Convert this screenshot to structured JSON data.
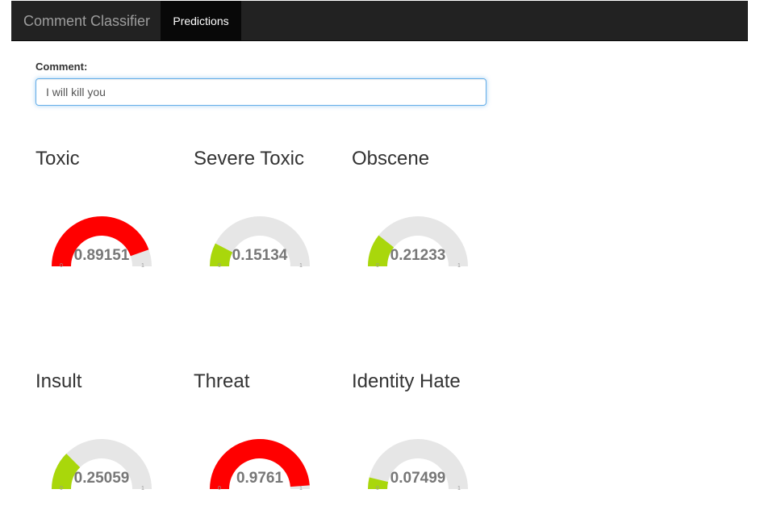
{
  "navbar": {
    "brand": "Comment Classifier",
    "tabs": [
      {
        "label": "Predictions",
        "active": true
      }
    ]
  },
  "comment": {
    "label": "Comment:",
    "value": "I will kill you"
  },
  "colors": {
    "high": "#ff0000",
    "low": "#a9d70b",
    "track": "#e6e6e6"
  },
  "gauges": [
    {
      "title": "Toxic",
      "value": 0.89151,
      "display": "0.89151",
      "min": "0",
      "max": "1"
    },
    {
      "title": "Severe Toxic",
      "value": 0.15134,
      "display": "0.15134",
      "min": "0",
      "max": "1"
    },
    {
      "title": "Obscene",
      "value": 0.21233,
      "display": "0.21233",
      "min": "0",
      "max": "1"
    },
    {
      "title": "Insult",
      "value": 0.25059,
      "display": "0.25059",
      "min": "0",
      "max": "1"
    },
    {
      "title": "Threat",
      "value": 0.9761,
      "display": "0.9761",
      "min": "0",
      "max": "1"
    },
    {
      "title": "Identity Hate",
      "value": 0.07499,
      "display": "0.07499",
      "min": "0",
      "max": "1"
    }
  ]
}
